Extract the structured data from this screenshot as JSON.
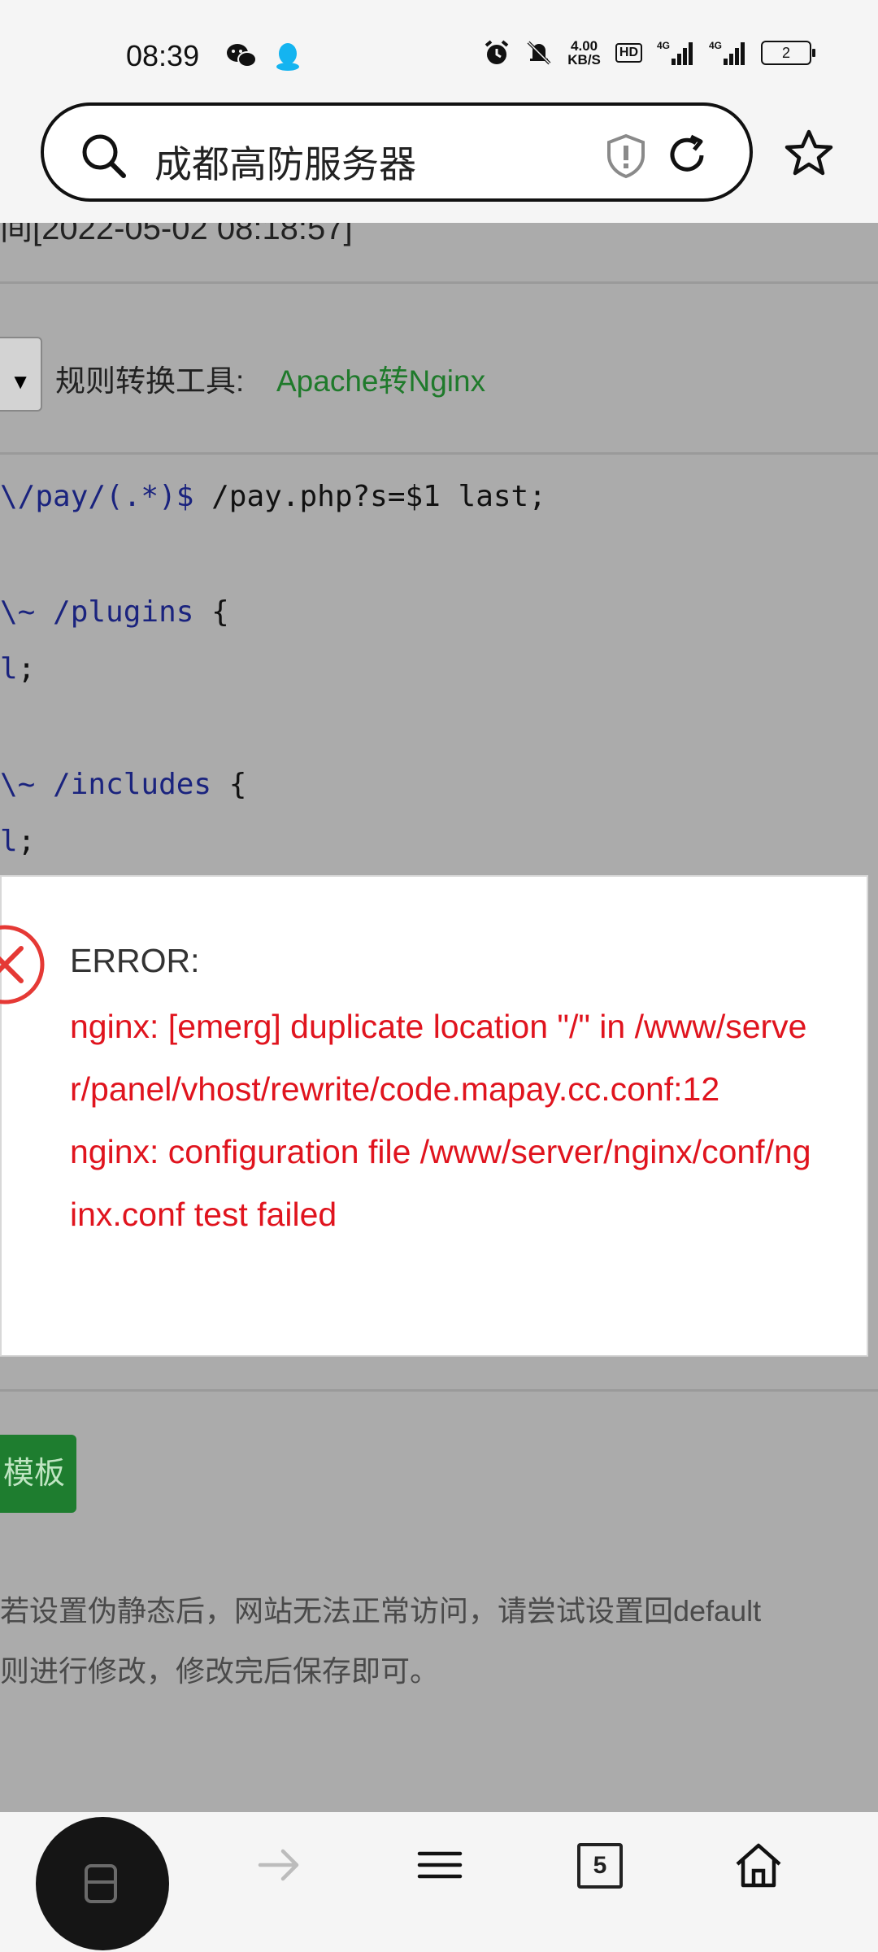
{
  "status_bar": {
    "time": "08:39",
    "net_speed_value": "4.00",
    "net_speed_unit": "KB/S",
    "hd_label": "HD",
    "sim1_label": "4G",
    "sim2_label": "4G",
    "battery_level": "2"
  },
  "address_bar": {
    "query": "成都高防服务器"
  },
  "page": {
    "partial_time_line": "间[2022-05-02 08:18:57]",
    "rule_tool_label": "规则转换工具:",
    "rule_tool_link": "Apache转Nginx",
    "select_arrow": "▼",
    "code_lines": [
      {
        "kw": "\\/pay/(.*)$",
        "rest": " /pay.php?s=$1 last;"
      },
      {
        "kw": "\\~ /plugins",
        "rest": " {"
      },
      {
        "kw": "l",
        "rest": ";"
      },
      {
        "kw": "\\~ /includes",
        "rest": " {"
      },
      {
        "kw": "l",
        "rest": ";"
      }
    ],
    "template_button": "模板",
    "tip_line1": "若设置伪静态后，网站无法正常访问，请尝试设置回default",
    "tip_line2": "则进行修改，修改完后保存即可。"
  },
  "dialog": {
    "title": "ERROR:",
    "message_line1": "nginx: [emerg] duplicate location \"/\" in /www/server/panel/vhost/rewrite/code.mapay.cc.conf:12",
    "message_line2": "nginx: configuration file /www/server/nginx/conf/nginx.conf test failed"
  },
  "bottom_nav": {
    "tabs_count": "5"
  },
  "colors": {
    "error_red": "#e0141e",
    "link_green": "#1f7a2b",
    "button_green": "#1e7d2f"
  }
}
